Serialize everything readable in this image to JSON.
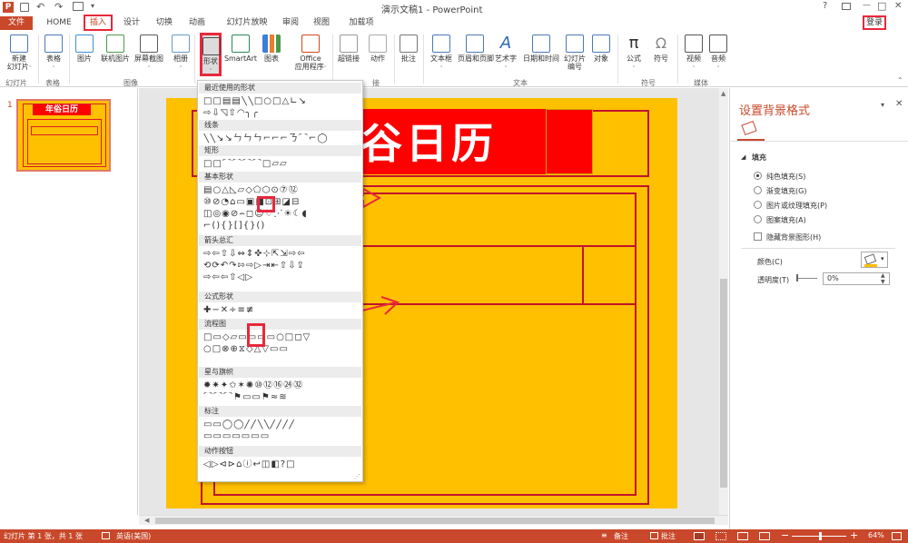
{
  "window": {
    "title": "演示文稿1 - PowerPoint",
    "help": "?",
    "minimize": "—",
    "restore": "□",
    "close": "✕"
  },
  "quick_access": {
    "logo": "P"
  },
  "login": "登录",
  "tabs": [
    "文件",
    "HOME",
    "插入",
    "设计",
    "切换",
    "动画",
    "幻灯片放映",
    "审阅",
    "视图",
    "加载项"
  ],
  "ribbon": {
    "buttons": [
      {
        "label": "新建\n幻灯片·",
        "icon": "new-slide"
      },
      {
        "label": "表格\n·",
        "icon": "table"
      },
      {
        "label": "图片",
        "icon": "picture"
      },
      {
        "label": "联机图片",
        "icon": "online-picture"
      },
      {
        "label": "屏幕截图\n·",
        "icon": "screenshot"
      },
      {
        "label": "相册\n·",
        "icon": "album"
      },
      {
        "label": "形状\n·",
        "icon": "shapes"
      },
      {
        "label": "SmartArt",
        "icon": "smartart"
      },
      {
        "label": "图表",
        "icon": "chart"
      },
      {
        "label": "Office\n应用程序·",
        "icon": "office"
      },
      {
        "label": "超链接",
        "icon": "hyperlink"
      },
      {
        "label": "动作",
        "icon": "action"
      },
      {
        "label": "批注",
        "icon": "comment"
      },
      {
        "label": "文本框\n·",
        "icon": "textbox"
      },
      {
        "label": "页眉和页脚",
        "icon": "header-footer"
      },
      {
        "label": "艺术字\n·",
        "icon": "wordart"
      },
      {
        "label": "日期和时间",
        "icon": "datetime"
      },
      {
        "label": "幻灯片\n编号",
        "icon": "slide-number"
      },
      {
        "label": "对象",
        "icon": "object"
      },
      {
        "label": "公式\n·",
        "icon": "equation"
      },
      {
        "label": "符号",
        "icon": "symbol"
      },
      {
        "label": "视频\n·",
        "icon": "video"
      },
      {
        "label": "音频\n·",
        "icon": "audio"
      }
    ],
    "groups": [
      "幻灯片",
      "表格",
      "图像",
      "接",
      "文本",
      "符号",
      "媒体"
    ]
  },
  "shapes_menu": {
    "sections": [
      {
        "title": "最近使用的形状",
        "rows": [
          "□□▤▤╲╲□○□△∟↘",
          "⇨⇩◹⇧◠╮╭"
        ]
      },
      {
        "title": "线条",
        "rows": [
          "╲╲↘↘ㄣㄣㄣ⌐⌐⌐ㄋ⌒⌐◯"
        ]
      },
      {
        "title": "矩形",
        "rows": [
          "□□⌒⌒⌒⌒□▱▱"
        ]
      },
      {
        "title": "基本形状",
        "rows": [
          "▤○△◺▱◇⬠⬡⊙⑦⑫",
          "⑩⊘◔⌂▭▣◨⊡⊞◪⊟",
          "◫◎◉⊘⌢◻☺♡⋰☀☾◖",
          "⌐(){}[]{}()"
        ]
      },
      {
        "title": "箭头总汇",
        "rows": [
          "⇨⇦⇧⇩⇔⇕✜⊹⇱⇲⇨⇦",
          "⟲⟳↶↷⇰⇨▷⇥⇤⇧⇩⇪",
          "⇨⇦⇦⇧◁▷"
        ]
      },
      {
        "title": "公式形状",
        "rows": [
          "✚−✕÷≡≢"
        ]
      },
      {
        "title": "流程图",
        "rows": [
          "□▭◇▱▭▭▭▭○□◻▽",
          "○□⊗⊕⧖◇△▽▭▭"
        ]
      },
      {
        "title": "星与旗帜",
        "rows": [
          "✹✷✦✩✶✺⑩⑫⑯㉔㉜",
          "⌒⌒⌒⚑▭▭⚑≈≋"
        ]
      },
      {
        "title": "标注",
        "rows": [
          "▭▭◯◯╱╱╲╲╱╱╱╱",
          "▭▭▭▭▭▭▭"
        ]
      },
      {
        "title": "动作按钮",
        "rows": [
          "◁▷⊲⊳⌂ⓘ↩◫◧?□"
        ]
      }
    ]
  },
  "slide": {
    "number": "1",
    "thumb_title": "年俗日历",
    "title_text": "谷日历"
  },
  "format_pane": {
    "title": "设置背景格式",
    "section": "填充",
    "options": [
      {
        "label": "纯色填充(S)",
        "checked": true
      },
      {
        "label": "渐变填充(G)",
        "checked": false
      },
      {
        "label": "图片或纹理填充(P)",
        "checked": false
      },
      {
        "label": "图案填充(A)",
        "checked": false
      }
    ],
    "hide_background": "隐藏背景图形(H)",
    "color_label": "颜色(C)",
    "transparency_label": "透明度(T)",
    "transparency_value": "0%"
  },
  "status": {
    "slide_info": "幻灯片 第 1 张，共 1 张",
    "language": "英语(美国)",
    "notes": "备注",
    "comments": "批注",
    "zoom": "64%"
  },
  "colors": {
    "accent": "#c9482b",
    "slide_bg": "#ffc000",
    "red": "#ff0000",
    "outline": "#c0142a",
    "annotation": "#e8283b"
  }
}
